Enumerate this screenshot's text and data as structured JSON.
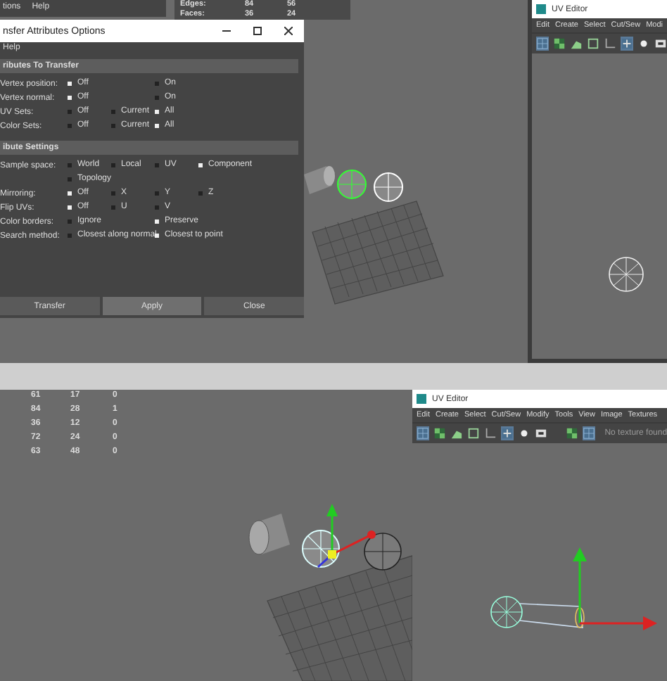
{
  "top": {
    "menu": [
      "tions",
      "Help"
    ],
    "stats": [
      {
        "label": "Edges:",
        "values": [
          "84",
          "56"
        ]
      },
      {
        "label": "Faces:",
        "values": [
          "36",
          "24"
        ]
      }
    ],
    "dialog": {
      "title": "nsfer Attributes Options",
      "menu": [
        "Help"
      ],
      "sections": [
        {
          "title": "ributes To Transfer",
          "rows": [
            {
              "label": "Vertex position:",
              "options": [
                {
                  "label": "Off",
                  "selected": true
                },
                {
                  "label": "On",
                  "selected": false
                }
              ]
            },
            {
              "label": "Vertex normal:",
              "options": [
                {
                  "label": "Off",
                  "selected": true
                },
                {
                  "label": "On",
                  "selected": false
                }
              ]
            },
            {
              "label": "UV Sets:",
              "options": [
                {
                  "label": "Off",
                  "selected": false
                },
                {
                  "label": "Current",
                  "selected": false
                },
                {
                  "label": "All",
                  "selected": true
                }
              ]
            },
            {
              "label": "Color Sets:",
              "options": [
                {
                  "label": "Off",
                  "selected": false
                },
                {
                  "label": "Current",
                  "selected": false
                },
                {
                  "label": "All",
                  "selected": true
                }
              ]
            }
          ]
        },
        {
          "title": "ibute Settings",
          "rows": [
            {
              "label": "Sample space:",
              "options": [
                {
                  "label": "World",
                  "selected": false
                },
                {
                  "label": "Local",
                  "selected": false
                },
                {
                  "label": "UV",
                  "selected": false
                },
                {
                  "label": "Component",
                  "selected": true
                },
                {
                  "label": "Topology",
                  "selected": false
                }
              ]
            },
            {
              "label": "Mirroring:",
              "options": [
                {
                  "label": "Off",
                  "selected": true
                },
                {
                  "label": "X",
                  "selected": false
                },
                {
                  "label": "Y",
                  "selected": false
                },
                {
                  "label": "Z",
                  "selected": false
                }
              ]
            },
            {
              "label": "Flip UVs:",
              "options": [
                {
                  "label": "Off",
                  "selected": true
                },
                {
                  "label": "U",
                  "selected": false
                },
                {
                  "label": "V",
                  "selected": false
                }
              ]
            },
            {
              "label": "Color borders:",
              "options": [
                {
                  "label": "Ignore",
                  "selected": false
                },
                {
                  "label": "Preserve",
                  "selected": true
                }
              ]
            },
            {
              "label": "Search method:",
              "options": [
                {
                  "label": "Closest along normal",
                  "selected": false
                },
                {
                  "label": "Closest to point",
                  "selected": true
                }
              ]
            }
          ]
        }
      ],
      "buttons": [
        {
          "label": "Transfer",
          "highlighted": false
        },
        {
          "label": "Apply",
          "highlighted": true
        },
        {
          "label": "Close",
          "highlighted": false
        }
      ]
    },
    "uv_editor": {
      "title": "UV Editor",
      "menu": [
        "Edit",
        "Create",
        "Select",
        "Cut/Sew",
        "Modi"
      ]
    }
  },
  "bottom": {
    "stats": [
      [
        "61",
        "17",
        "0"
      ],
      [
        "84",
        "28",
        "1"
      ],
      [
        "36",
        "12",
        "0"
      ],
      [
        "72",
        "24",
        "0"
      ],
      [
        "63",
        "48",
        "0"
      ]
    ],
    "uv_editor": {
      "title": "UV Editor",
      "menu": [
        "Edit",
        "Create",
        "Select",
        "Cut/Sew",
        "Modify",
        "Tools",
        "View",
        "Image",
        "Textures"
      ],
      "texture_status": "No texture found"
    }
  }
}
